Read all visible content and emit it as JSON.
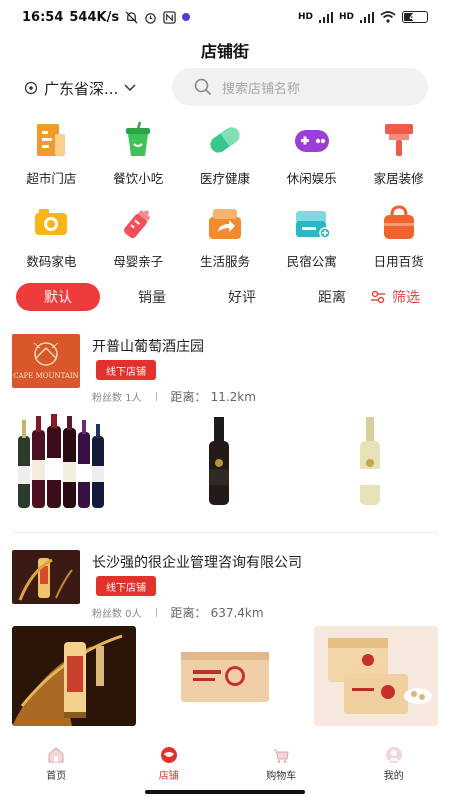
{
  "status": {
    "time": "16:54",
    "speed": "544K/s",
    "signal1": "HD",
    "signal2": "HD",
    "battery": "41"
  },
  "header": {
    "title": "店铺街"
  },
  "location": {
    "label": "广东省深..."
  },
  "search": {
    "placeholder": "搜索店铺名称"
  },
  "categories": [
    {
      "label": "超市门店",
      "icon": "receipt-icon",
      "color": "#f29a2e"
    },
    {
      "label": "餐饮小吃",
      "icon": "drink-cup-icon",
      "color": "#3fc25a"
    },
    {
      "label": "医疗健康",
      "icon": "pill-icon",
      "color": "#36c98d"
    },
    {
      "label": "休闲娱乐",
      "icon": "gamepad-icon",
      "color": "#9b3fd6"
    },
    {
      "label": "家居装修",
      "icon": "paint-roller-icon",
      "color": "#f05a4a"
    },
    {
      "label": "数码家电",
      "icon": "camera-icon",
      "color": "#f7b518"
    },
    {
      "label": "母婴亲子",
      "icon": "baby-bottle-icon",
      "color": "#f1505a"
    },
    {
      "label": "生活服务",
      "icon": "share-box-icon",
      "color": "#f28a2e"
    },
    {
      "label": "民宿公寓",
      "icon": "bed-icon",
      "color": "#2bb7c6"
    },
    {
      "label": "日用百货",
      "icon": "bag-icon",
      "color": "#f0632e"
    }
  ],
  "sort": {
    "default": "默认",
    "sales": "销量",
    "rating": "好评",
    "distance": "距离",
    "filter": "筛选"
  },
  "stores": [
    {
      "name": "开普山葡萄酒庄园",
      "tag": "线下店铺",
      "fans": "粉丝数 1人",
      "distance_label": "距离：",
      "distance": "11.2km",
      "logo_text": "CAPE MOUNTAIN"
    },
    {
      "name": "长沙强的很企业管理咨询有限公司",
      "tag": "线下店铺",
      "fans": "粉丝数 0人",
      "distance_label": "距离：",
      "distance": "637.4km"
    }
  ],
  "bottom_nav": [
    {
      "label": "首页",
      "active": false
    },
    {
      "label": "店铺",
      "active": true
    },
    {
      "label": "购物车",
      "active": false
    },
    {
      "label": "我的",
      "active": false
    }
  ],
  "colors": {
    "accent": "#e3312d",
    "sort_active": "#ef3b3b"
  }
}
